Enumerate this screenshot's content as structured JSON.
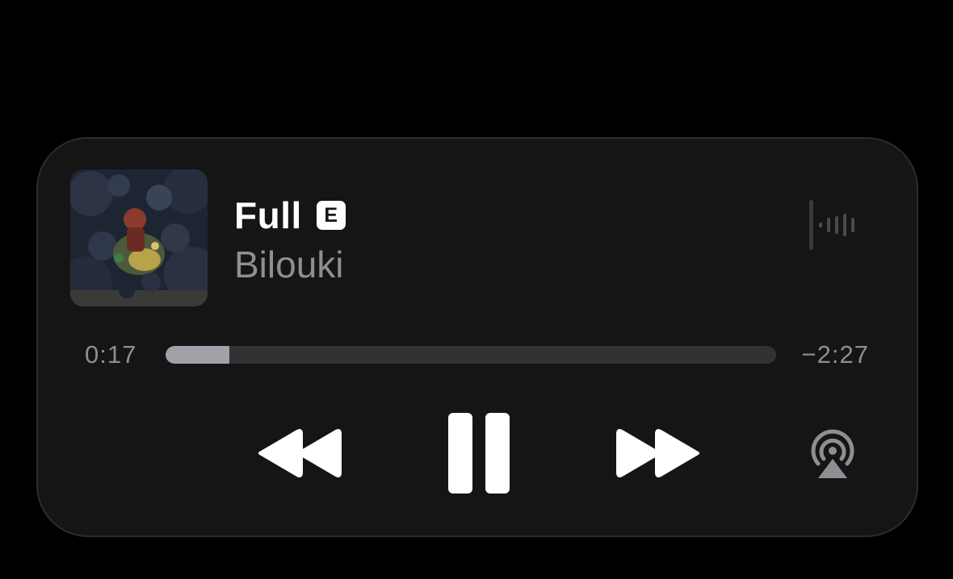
{
  "track": {
    "title": "Full",
    "explicit_badge": "E",
    "artist": "Bilouki"
  },
  "playback": {
    "elapsed": "0:17",
    "remaining": "−2:27",
    "progress_fraction": 0.104,
    "state": "playing"
  },
  "controls": {
    "rewind_icon": "backward-icon",
    "pause_icon": "pause-icon",
    "forward_icon": "forward-icon",
    "airplay_icon": "airplay-audio-icon",
    "waveform_icon": "audio-waveform-icon"
  },
  "colors": {
    "panel": "#151515",
    "primary_text": "#ffffff",
    "secondary_text": "#8e8e93",
    "track": "#323234",
    "fill": "#a1a1a8"
  }
}
